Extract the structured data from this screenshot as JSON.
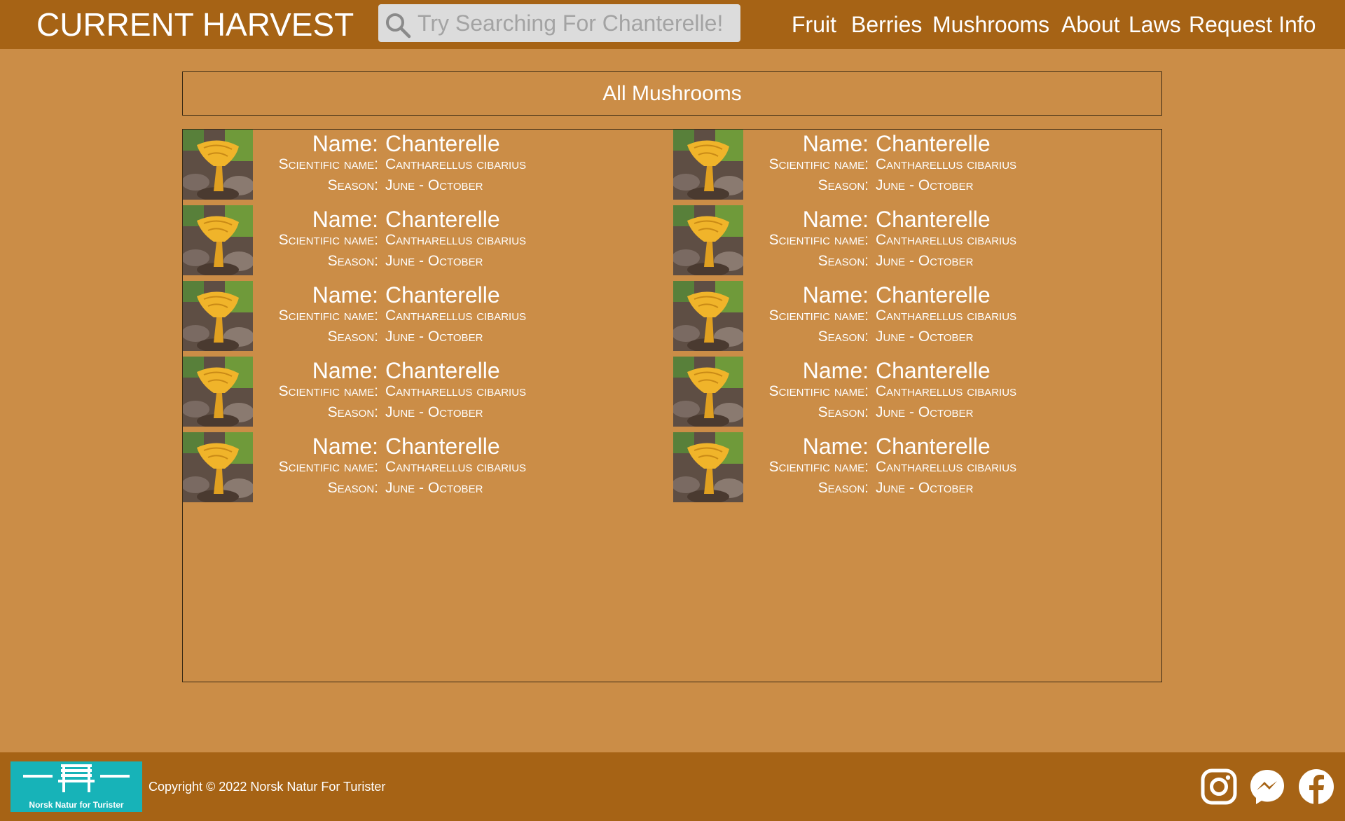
{
  "header": {
    "brand": "CURRENT HARVEST",
    "search_placeholder": "Try Searching For Chanterelle!",
    "search_icon": "search-icon",
    "nav": [
      {
        "label": "Fruit"
      },
      {
        "label": "Berries"
      },
      {
        "label": "Mushrooms"
      },
      {
        "label": "About"
      },
      {
        "label": "Laws"
      },
      {
        "label": "Request Info"
      }
    ]
  },
  "main": {
    "section_title": "All Mushrooms",
    "labels": {
      "name": "Name:",
      "scientific_name": "Scientific name:",
      "season": "Season:"
    },
    "items": [
      {
        "name": "Chanterelle",
        "scientific_name": "Cantharellus cibarius",
        "season": "June - October"
      },
      {
        "name": "Chanterelle",
        "scientific_name": "Cantharellus cibarius",
        "season": "June - October"
      },
      {
        "name": "Chanterelle",
        "scientific_name": "Cantharellus cibarius",
        "season": "June - October"
      },
      {
        "name": "Chanterelle",
        "scientific_name": "Cantharellus cibarius",
        "season": "June - October"
      },
      {
        "name": "Chanterelle",
        "scientific_name": "Cantharellus cibarius",
        "season": "June - October"
      },
      {
        "name": "Chanterelle",
        "scientific_name": "Cantharellus cibarius",
        "season": "June - October"
      },
      {
        "name": "Chanterelle",
        "scientific_name": "Cantharellus cibarius",
        "season": "June - October"
      },
      {
        "name": "Chanterelle",
        "scientific_name": "Cantharellus cibarius",
        "season": "June - October"
      },
      {
        "name": "Chanterelle",
        "scientific_name": "Cantharellus cibarius",
        "season": "June - October"
      },
      {
        "name": "Chanterelle",
        "scientific_name": "Cantharellus cibarius",
        "season": "June - October"
      }
    ]
  },
  "footer": {
    "logo_text": "Norsk Natur for Turister",
    "copyright": "Copyright © 2022 Norsk Natur For Turister",
    "social": [
      "instagram-icon",
      "messenger-icon",
      "facebook-icon"
    ]
  },
  "colors": {
    "bar": "#a66315",
    "page": "#cb8d47",
    "logo": "#17b3b8"
  }
}
